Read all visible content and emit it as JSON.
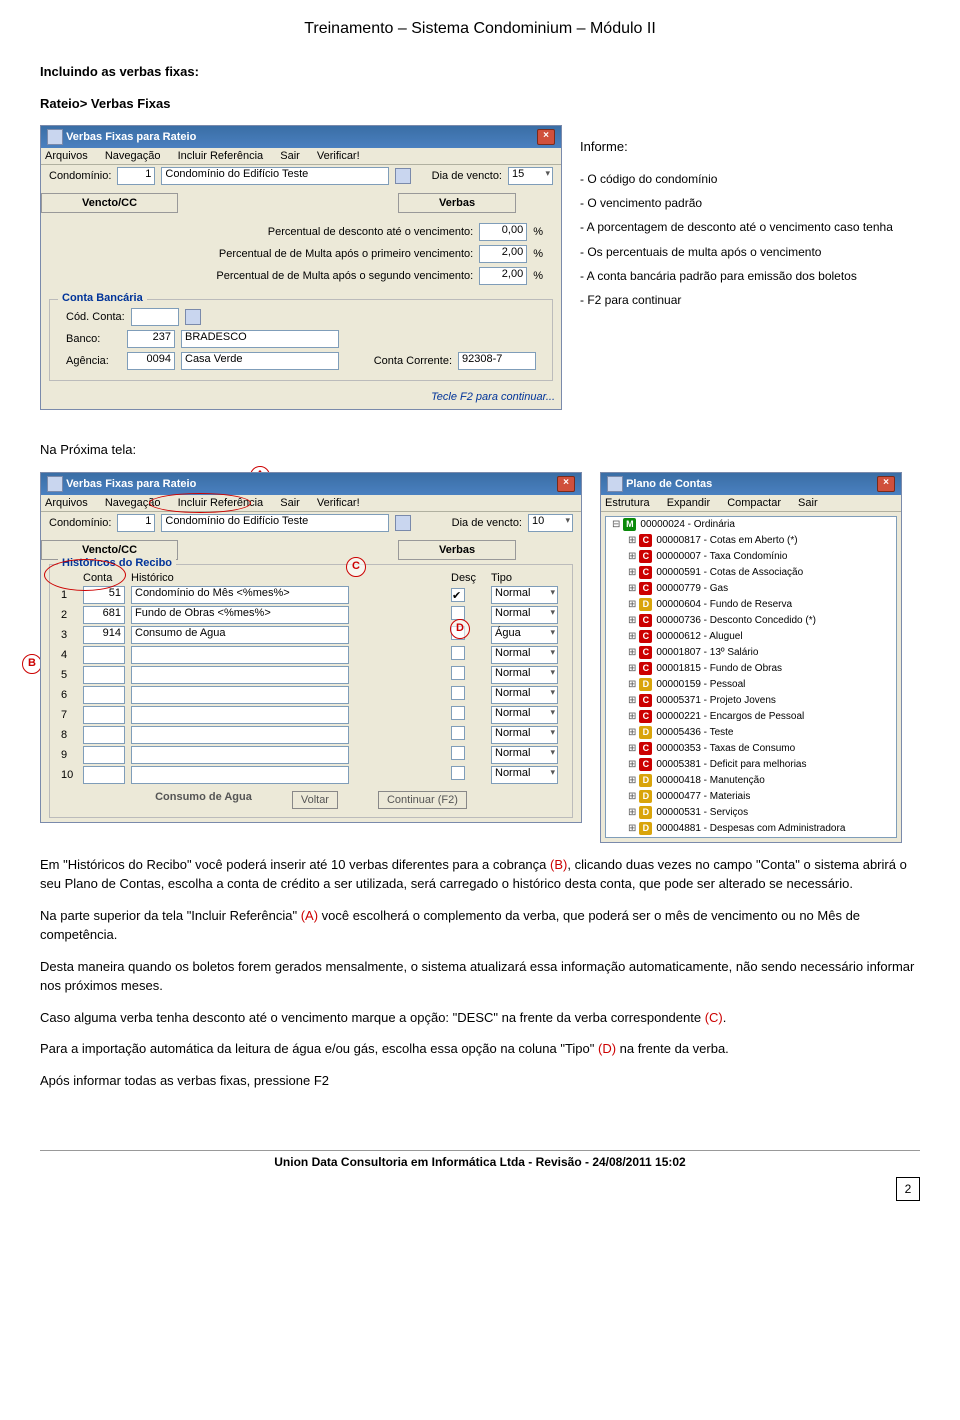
{
  "doc": {
    "title": "Treinamento – Sistema Condominium – Módulo II",
    "heading1": "Incluindo as verbas fixas:",
    "heading2": "Rateio> Verbas Fixas",
    "informe": "Informe:",
    "bullets": [
      "- O código do condomínio",
      "- O vencimento padrão",
      "- A porcentagem de desconto até o vencimento caso tenha",
      "- Os percentuais de multa após o vencimento",
      "- A conta bancária padrão para emissão dos boletos",
      "- F2 para continuar"
    ],
    "proxima": "Na Próxima tela:",
    "p1a": "Em \"Históricos do Recibo\" você poderá inserir até 10 verbas diferentes para a cobrança ",
    "p1b": "(B)",
    "p1c": ", clicando duas vezes no campo \"Conta\" o sistema abrirá o seu Plano de Contas, escolha a conta de crédito a ser utilizada, será carregado o histórico desta conta, que pode ser alterado se necessário.",
    "p2a": "Na parte superior da tela \"Incluir Referência\" ",
    "p2b": "(A)",
    "p2c": " você escolherá o complemento da verba, que poderá ser o mês de vencimento ou no Mês de competência.",
    "p3": "Desta maneira quando os boletos forem gerados mensalmente, o sistema atualizará essa informação automaticamente, não sendo necessário informar nos próximos meses.",
    "p4a": "Caso alguma verba tenha desconto até o vencimento marque a opção: \"DESC\" na frente da verba correspondente ",
    "p4b": "(C)",
    "p4c": ".",
    "p5a": "Para a importação automática da leitura de água e/ou gás, escolha essa opção na coluna \"Tipo\" ",
    "p5b": "(D)",
    "p5c": " na frente da verba.",
    "p6": "Após informar todas as verbas fixas, pressione F2",
    "footer": "Union Data Consultoria em Informática Ltda - Revisão - 24/08/2011 15:02",
    "page": "2"
  },
  "win1": {
    "title": "Verbas Fixas para Rateio",
    "menu": [
      "Arquivos",
      "Navegação",
      "Incluir Referência",
      "Sair",
      "Verificar!"
    ],
    "lbl_cond": "Condomínio:",
    "val_cond_num": "1",
    "val_cond_name": "Condomínio do Edifício Teste",
    "lbl_vencto": "Dia de vencto:",
    "val_vencto": "15",
    "tab_left": "Vencto/CC",
    "tab_right": "Verbas",
    "perc_desc_lbl": "Percentual de desconto até o vencimento:",
    "perc_desc_val": "0,00",
    "perc_multa1_lbl": "Percentual de de Multa após o primeiro vencimento:",
    "perc_multa1_val": "2,00",
    "perc_multa2_lbl": "Percentual de de Multa após o segundo vencimento:",
    "perc_multa2_val": "2,00",
    "pct": "%",
    "grp_conta": "Conta Bancária",
    "lbl_codconta": "Cód. Conta:",
    "lbl_banco": "Banco:",
    "val_banco_num": "237",
    "val_banco_name": "BRADESCO",
    "lbl_agencia": "Agência:",
    "val_agencia_num": "0094",
    "val_agencia_name": "Casa Verde",
    "lbl_cc": "Conta Corrente:",
    "val_cc": "92308-7",
    "status": "Tecle F2 para continuar..."
  },
  "win2": {
    "title": "Verbas Fixas para Rateio",
    "menu": [
      "Arquivos",
      "Navegação",
      "Incluir Referência",
      "Sair",
      "Verificar!"
    ],
    "lbl_cond": "Condomínio:",
    "val_cond_num": "1",
    "val_cond_name": "Condomínio do Edifício Teste",
    "lbl_vencto": "Dia de vencto:",
    "val_vencto": "10",
    "tab_left": "Vencto/CC",
    "tab_right": "Verbas",
    "grp_hist": "Históricos do Recibo",
    "hdr": [
      "Conta",
      "Histórico",
      "Desç",
      "Tipo"
    ],
    "rows": [
      {
        "n": "1",
        "conta": "51",
        "hist": "Condomínio do Mês <%mes%>",
        "chk": true,
        "tipo": "Normal"
      },
      {
        "n": "2",
        "conta": "681",
        "hist": "Fundo de Obras <%mes%>",
        "chk": false,
        "tipo": "Normal"
      },
      {
        "n": "3",
        "conta": "914",
        "hist": "Consumo de Agua",
        "chk": false,
        "tipo": "Água"
      },
      {
        "n": "4",
        "conta": "",
        "hist": "",
        "chk": false,
        "tipo": "Normal"
      },
      {
        "n": "5",
        "conta": "",
        "hist": "",
        "chk": false,
        "tipo": "Normal"
      },
      {
        "n": "6",
        "conta": "",
        "hist": "",
        "chk": false,
        "tipo": "Normal"
      },
      {
        "n": "7",
        "conta": "",
        "hist": "",
        "chk": false,
        "tipo": "Normal"
      },
      {
        "n": "8",
        "conta": "",
        "hist": "",
        "chk": false,
        "tipo": "Normal"
      },
      {
        "n": "9",
        "conta": "",
        "hist": "",
        "chk": false,
        "tipo": "Normal"
      },
      {
        "n": "10",
        "conta": "",
        "hist": "",
        "chk": false,
        "tipo": "Normal"
      }
    ],
    "bottom_hist": "Consumo de Agua",
    "btn_voltar": "Voltar",
    "btn_cont": "Continuar (F2)"
  },
  "win3": {
    "title": "Plano de Contas",
    "menu": [
      "Estrutura",
      "Expandir",
      "Compactar",
      "Sair"
    ],
    "root": "00000024 - Ordinária",
    "items": [
      {
        "t": "C",
        "txt": "00000817 - Cotas em Aberto (*)"
      },
      {
        "t": "C",
        "txt": "00000007 - Taxa Condomínio"
      },
      {
        "t": "C",
        "txt": "00000591 - Cotas de Associação"
      },
      {
        "t": "C",
        "txt": "00000779 - Gas"
      },
      {
        "t": "D",
        "txt": "00000604 - Fundo de Reserva"
      },
      {
        "t": "C",
        "txt": "00000736 - Desconto Concedido (*)"
      },
      {
        "t": "C",
        "txt": "00000612 - Aluguel"
      },
      {
        "t": "C",
        "txt": "00001807 - 13º Salário"
      },
      {
        "t": "C",
        "txt": "00001815 - Fundo de Obras"
      },
      {
        "t": "D",
        "txt": "00000159 - Pessoal"
      },
      {
        "t": "C",
        "txt": "00005371 - Projeto Jovens"
      },
      {
        "t": "C",
        "txt": "00000221 - Encargos de Pessoal"
      },
      {
        "t": "D",
        "txt": "00005436 - Teste"
      },
      {
        "t": "C",
        "txt": "00000353 - Taxas de Consumo"
      },
      {
        "t": "C",
        "txt": "00005381 - Deficit para melhorias"
      },
      {
        "t": "D",
        "txt": "00000418 - Manutenção"
      },
      {
        "t": "D",
        "txt": "00000477 - Materiais"
      },
      {
        "t": "D",
        "txt": "00000531 - Serviços"
      },
      {
        "t": "D",
        "txt": "00004881 - Despesas com Administradora"
      }
    ]
  },
  "letters": {
    "A": "A",
    "B": "B",
    "C": "C",
    "D": "D"
  }
}
